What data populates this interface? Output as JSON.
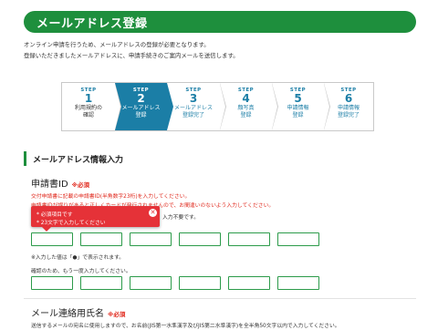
{
  "header": {
    "title": "メールアドレス登録"
  },
  "intro": {
    "line1": "オンライン申請を行うため、メールアドレスの登録が必要となります。",
    "line2": "登録いただきましたメールアドレスに、申請手続きのご案内メールを送信します。"
  },
  "steps": [
    {
      "label": "STEP",
      "num": "1",
      "name1": "利用規約の",
      "name2": "確認",
      "state": "done"
    },
    {
      "label": "STEP",
      "num": "2",
      "name1": "メールアドレス",
      "name2": "登録",
      "state": "active"
    },
    {
      "label": "STEP",
      "num": "3",
      "name1": "メールアドレス",
      "name2": "登録完了",
      "state": "todo"
    },
    {
      "label": "STEP",
      "num": "4",
      "name1": "顔写真",
      "name2": "登録",
      "state": "todo"
    },
    {
      "label": "STEP",
      "num": "5",
      "name1": "申請情報",
      "name2": "登録",
      "state": "todo"
    },
    {
      "label": "STEP",
      "num": "6",
      "name1": "申請情報",
      "name2": "登録完了",
      "state": "todo"
    }
  ],
  "section": {
    "title": "メールアドレス情報入力"
  },
  "field1": {
    "title": "申請書ID",
    "required": "※必須",
    "instruction1": "交付申請書に記載の申請書ID(半角数字23桁)を入力してください。",
    "instruction2": "申請書IDが誤りがあると正しくカードが発行されませんので、お間違いのないよう入力してください。",
    "instruction3": "入力不要です。",
    "note_masked": "※入力した値は「●」で表示されます。",
    "note_confirm": "確認のため、もう一度入力してください。"
  },
  "tooltip": {
    "line1": "* 必須項目です",
    "line2": "* 23文字で入力してください",
    "close_icon": "close-icon"
  },
  "field2": {
    "title": "メール連絡用氏名",
    "required": "※必須",
    "instruction": "送信するメールの宛名に使用しますので、お名前(JIS第一水準漢字及びJIS第二水準漢字)を全半角50文字以内で入力してください。"
  },
  "colors": {
    "header": "#1e8f3d",
    "step_active": "#1b7ea6",
    "required": "#e0271b",
    "tooltip": "#e53238",
    "input_border": "#2c9b4a"
  }
}
